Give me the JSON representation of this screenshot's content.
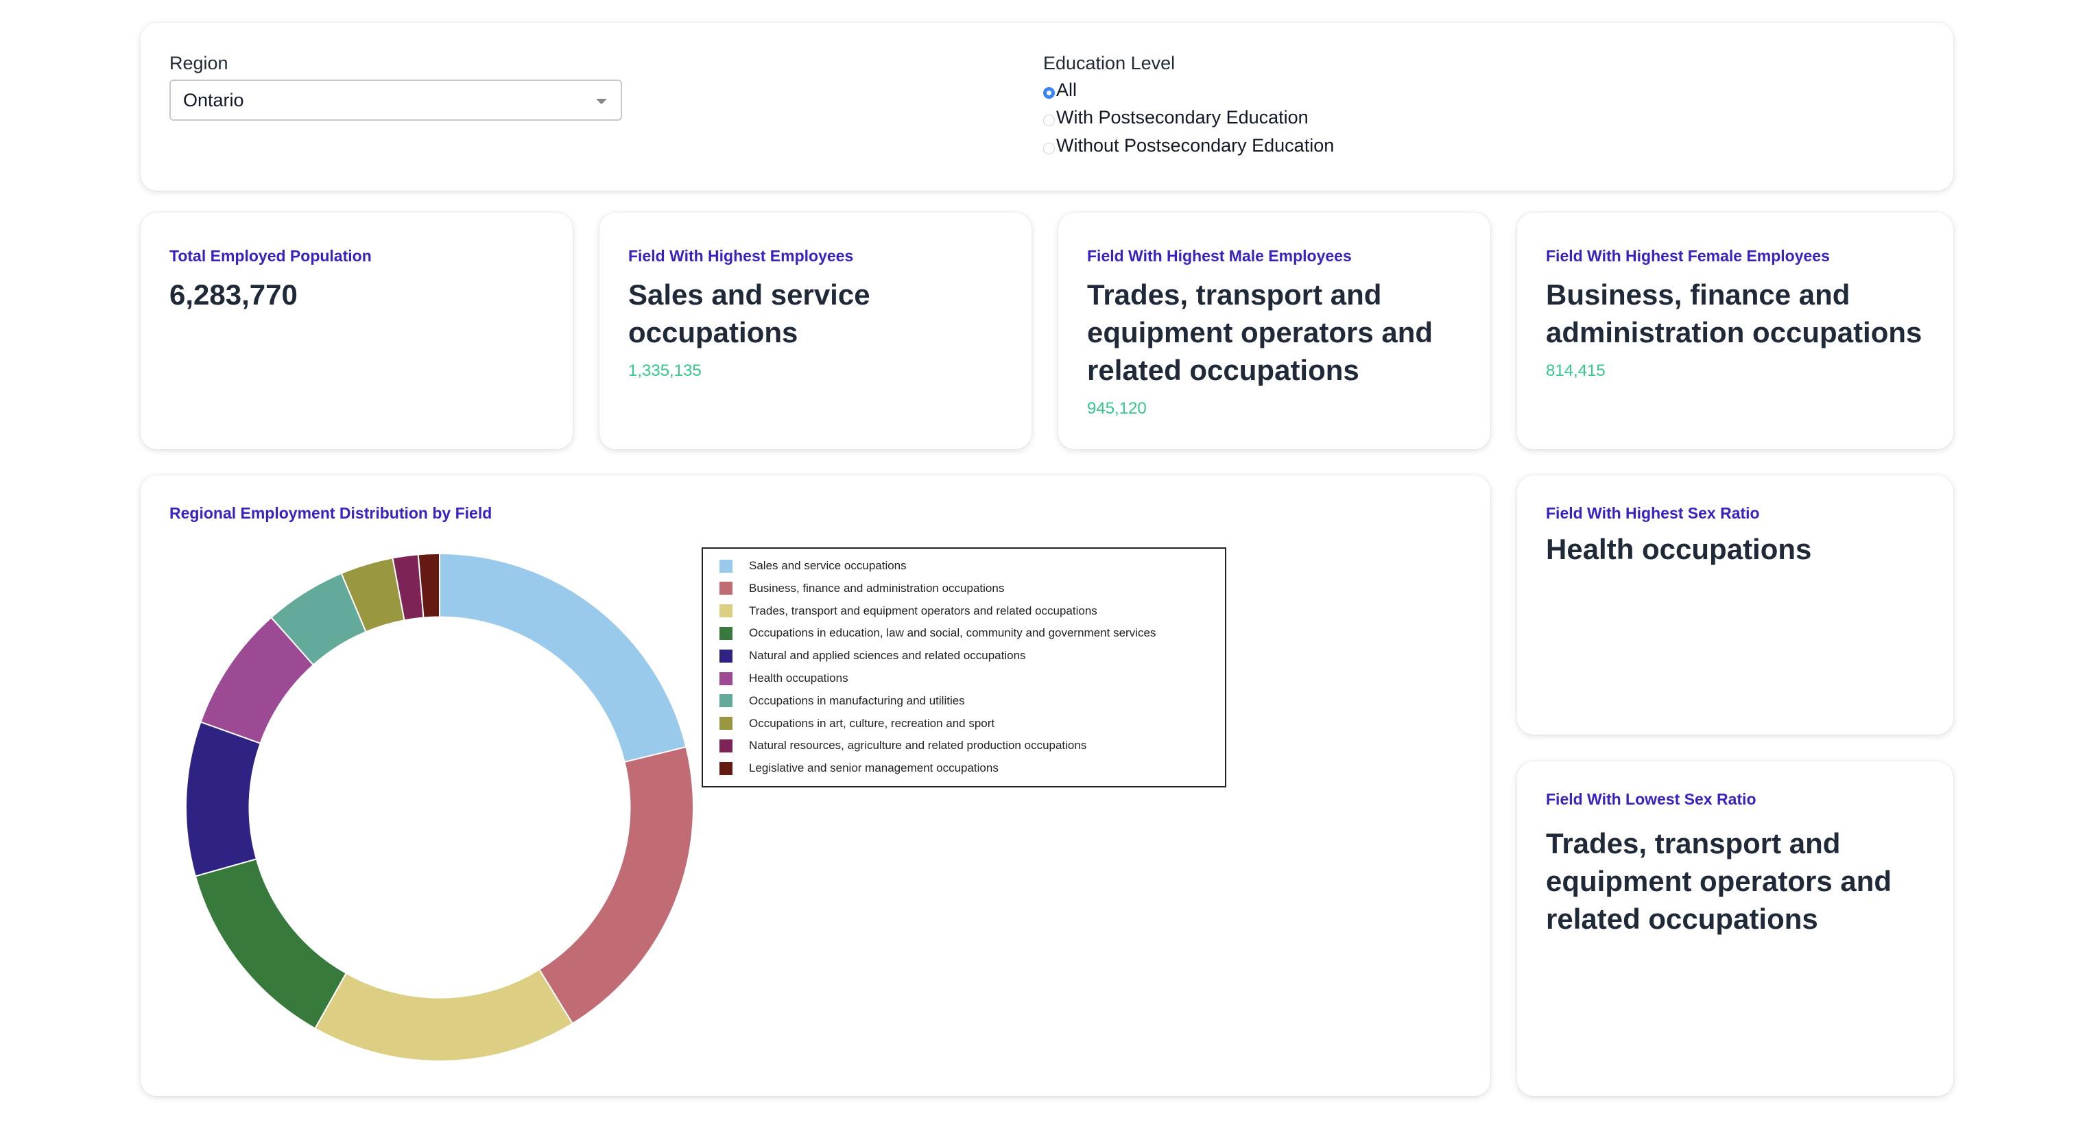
{
  "filters": {
    "region_label": "Region",
    "region_value": "Ontario",
    "education_label": "Education Level",
    "education_options": [
      {
        "label": "All",
        "checked": true
      },
      {
        "label": "With Postsecondary Education",
        "checked": false
      },
      {
        "label": "Without Postsecondary Education",
        "checked": false
      }
    ]
  },
  "kpis": {
    "total": {
      "title": "Total Employed Population",
      "value": "6,283,770"
    },
    "highest": {
      "title": "Field With Highest Employees",
      "value": "Sales and service occupations",
      "sub": "1,335,135"
    },
    "male": {
      "title": "Field With Highest Male Employees",
      "value": "Trades, transport and equipment operators and related occupations",
      "sub": "945,120"
    },
    "female": {
      "title": "Field With Highest Female Employees",
      "value": "Business, finance and administration occupations",
      "sub": "814,415"
    },
    "highest_ratio": {
      "title": "Field With Highest Sex Ratio",
      "value": "Health occupations"
    },
    "lowest_ratio": {
      "title": "Field With Lowest Sex Ratio",
      "value": "Trades, transport and equipment operators and related occupations"
    }
  },
  "chart_title": "Regional Employment Distribution by Field",
  "colors": {
    "accent_title": "#3a22c2",
    "accent_sub": "#34c88a",
    "radio_checked": "#3b82f6"
  },
  "chart_data": {
    "type": "pie",
    "hole": 0.75,
    "direction": "clockwise",
    "start_angle": "top",
    "legend_position": "right",
    "categories": [
      "Sales and service occupations",
      "Business, finance and administration occupations",
      "Trades, transport and equipment operators and related occupations",
      "Occupations in education, law and social, community and government services",
      "Natural and applied sciences and related occupations",
      "Health occupations",
      "Occupations in manufacturing and utilities",
      "Occupations in art, culture, recreation and sport",
      "Natural resources, agriculture and related production occupations",
      "Legislative and senior management occupations"
    ],
    "values": [
      1335135,
      1264300,
      1068000,
      785500,
      620000,
      504000,
      329000,
      212000,
      102000,
      85000
    ],
    "colors": [
      "#99c9eb",
      "#c16b75",
      "#dccf83",
      "#387a3b",
      "#2e2283",
      "#9d4a94",
      "#63aa9b",
      "#999840",
      "#7e2356",
      "#641a12"
    ],
    "sort": "descending"
  }
}
